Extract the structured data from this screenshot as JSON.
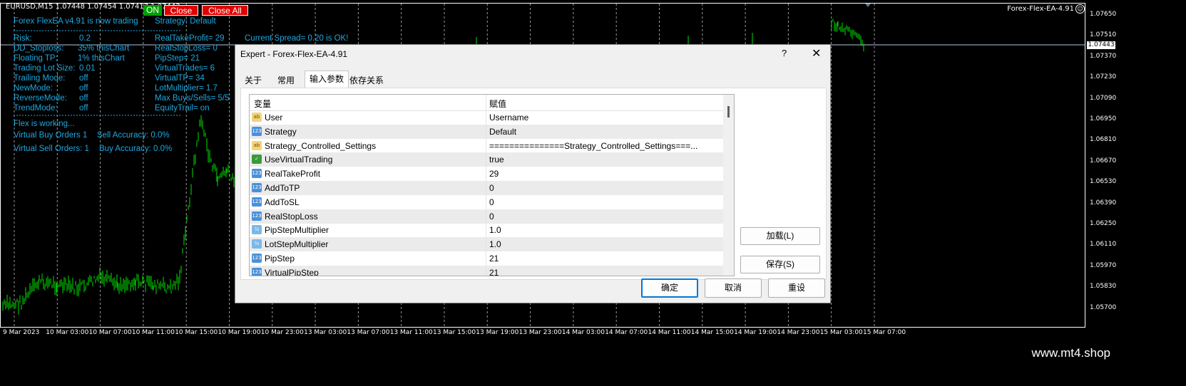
{
  "chart": {
    "symbol_info": "EURUSD,M15  1.07448 1.07454 1.07417 1.07443",
    "on_label": "ON",
    "close_label": "Close",
    "close_all_label": "Close All",
    "ea_name": "Forex-Flex-EA-4.91",
    "current_price": "1.07443",
    "price_levels": [
      "1.07650",
      "1.07510",
      "1.07370",
      "1.07230",
      "1.07090",
      "1.06950",
      "1.06810",
      "1.06670",
      "1.06530",
      "1.06390",
      "1.06250",
      "1.06110",
      "1.05970",
      "1.05830",
      "1.05700"
    ],
    "time_labels": [
      "9 Mar 2023",
      "10 Mar 03:00",
      "10 Mar 07:00",
      "10 Mar 11:00",
      "10 Mar 15:00",
      "10 Mar 19:00",
      "10 Mar 23:00",
      "13 Mar 03:00",
      "13 Mar 07:00",
      "13 Mar 11:00",
      "13 Mar 15:00",
      "13 Mar 19:00",
      "13 Mar 23:00",
      "14 Mar 03:00",
      "14 Mar 07:00",
      "14 Mar 11:00",
      "14 Mar 15:00",
      "14 Mar 19:00",
      "14 Mar 23:00",
      "15 Mar 03:00",
      "15 Mar 07:00"
    ]
  },
  "overlay": {
    "status": "Forex FlexEA v4.91 is now trading",
    "strategy": "Strategy: Default",
    "risk_label": "Risk:",
    "risk_value": "0.2",
    "dd_label": "DD_Stoploss:",
    "dd_value": "35%  thisChart",
    "ftp_label": "Floating TP:",
    "ftp_value": "1%  thisChart",
    "lot_label": "Trading Lot Size:",
    "lot_value": "0.01",
    "trailing_label": "Trailing Mode:",
    "trailing_value": "off",
    "newmode_label": "NewMode:",
    "newmode_value": "off",
    "reverse_label": "ReverseMode:",
    "reverse_value": "off",
    "trend_label": "TrendMode:",
    "trend_value": "off",
    "real_tp": "RealTakeProfit= 29",
    "real_sl": "RealStopLoss= 0",
    "pipstep": "PipStep= 21",
    "virtual_trades": "VirtualTrades= 6",
    "virtual_tp": "VirtualTP= 34",
    "lot_multiplier": "LotMultiplier= 1.7",
    "max_buys": "Max Buys/Sells= 5/5",
    "equity_trail": "EquityTrail= on",
    "spread": "Current Spread= 0.20 is OK!",
    "working": "Flex is working...",
    "vbuy": "Virtual Buy Orders 1",
    "sell_acc": "Sell Accuracy: 0.0%",
    "vsell": "Virtual Sell Orders: 1",
    "buy_acc": "Buy Accuracy: 0.0%"
  },
  "dialog": {
    "title": "Expert - Forex-Flex-EA-4.91",
    "help": "?",
    "close": "✕",
    "tabs": [
      "关于",
      "常用",
      "输入参数",
      "依存关系"
    ],
    "col_variable": "变量",
    "col_value": "赋值",
    "rows": [
      {
        "icon": "ab",
        "name": "User",
        "value": "Username"
      },
      {
        "icon": "123",
        "name": "Strategy",
        "value": "Default"
      },
      {
        "icon": "ab",
        "name": "Strategy_Controlled_Settings",
        "value": "===============Strategy_Controlled_Settings===..."
      },
      {
        "icon": "bool",
        "name": "UseVirtualTrading",
        "value": "true"
      },
      {
        "icon": "123",
        "name": "RealTakeProfit",
        "value": "29"
      },
      {
        "icon": "123",
        "name": "AddToTP",
        "value": "0"
      },
      {
        "icon": "123",
        "name": "AddToSL",
        "value": "0"
      },
      {
        "icon": "123",
        "name": "RealStopLoss",
        "value": "0"
      },
      {
        "icon": "dbl",
        "name": "PipStepMultiplier",
        "value": "1.0"
      },
      {
        "icon": "dbl",
        "name": "LotStepMultiplier",
        "value": "1.0"
      },
      {
        "icon": "123",
        "name": "PipStep",
        "value": "21"
      },
      {
        "icon": "123",
        "name": "VirtualPipStep",
        "value": "21"
      }
    ],
    "load_button": "加载(L)",
    "save_button": "保存(S)",
    "ok_button": "确定",
    "cancel_button": "取消",
    "reset_button": "重设"
  },
  "watermark": "www.mt4.shop"
}
